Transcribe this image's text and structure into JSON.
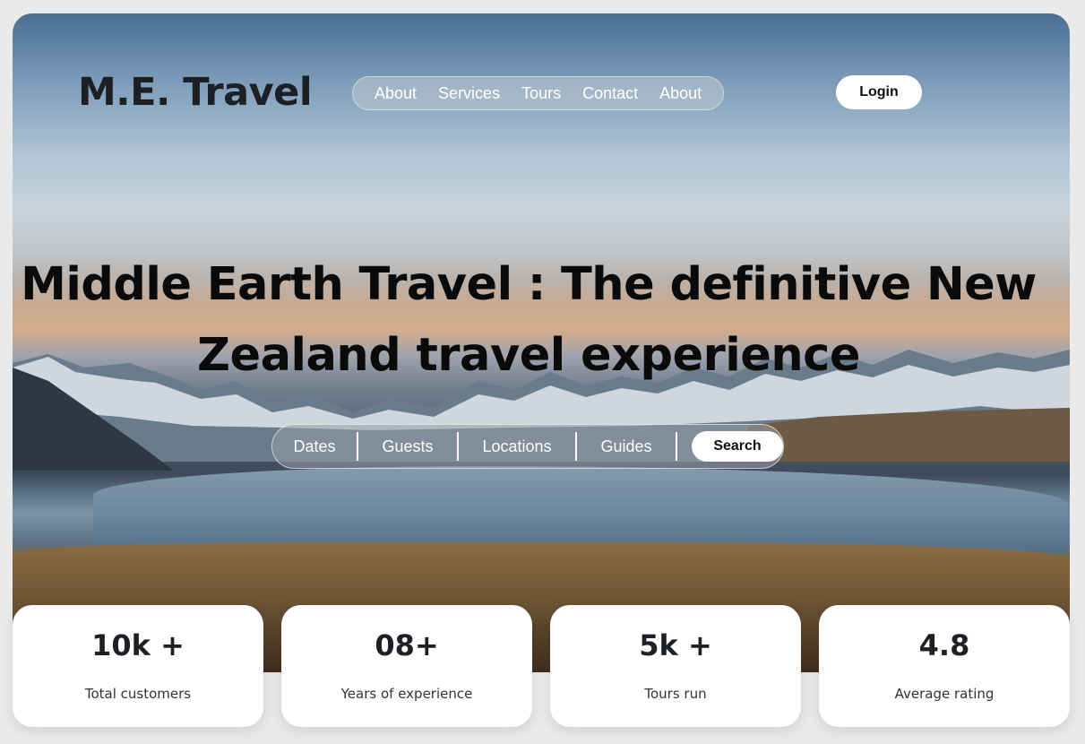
{
  "brand": "M.E. Travel",
  "nav": [
    "About",
    "Services",
    "Tours",
    "Contact",
    "About"
  ],
  "login_label": "Login",
  "headline": "Middle Earth Travel : The definitive New Zealand travel experience",
  "search": {
    "items": [
      "Dates",
      "Guests",
      "Locations",
      "Guides"
    ],
    "button_label": "Search"
  },
  "stats": [
    {
      "value": "10k +",
      "label": "Total customers"
    },
    {
      "value": "08+",
      "label": "Years of experience"
    },
    {
      "value": "5k +",
      "label": "Tours run"
    },
    {
      "value": "4.8",
      "label": "Average rating"
    }
  ]
}
